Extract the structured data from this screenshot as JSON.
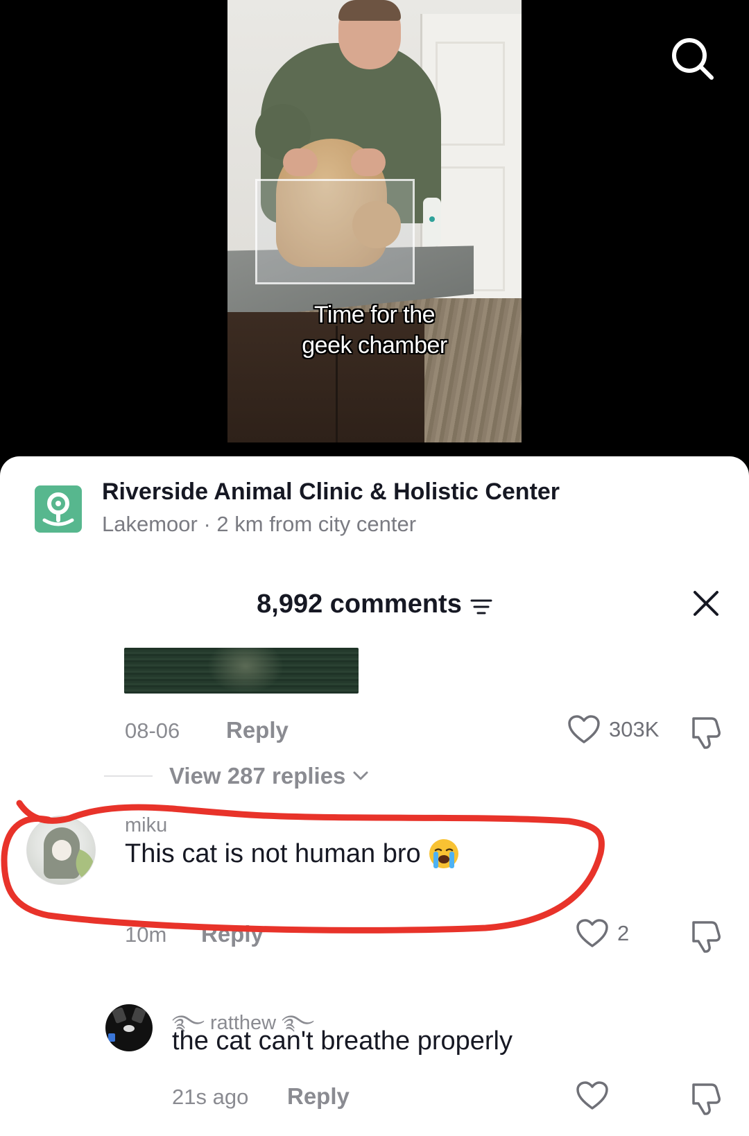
{
  "video": {
    "caption_lines": [
      "Time for the",
      "geek chamber"
    ]
  },
  "location": {
    "title": "Riverside Animal Clinic & Holistic Center",
    "subtitle": "Lakemoor · 2 km from city center",
    "icon": "location-pin-icon",
    "icon_color": "#57b78e"
  },
  "comments_header": {
    "count_label": "8,992 comments"
  },
  "comments": [
    {
      "time": "08-06",
      "reply_label": "Reply",
      "likes": "303K",
      "view_replies_label": "View 287 replies"
    },
    {
      "username": "miku",
      "text": "This cat is not human bro",
      "emoji": "loudly-crying-face",
      "time": "10m",
      "reply_label": "Reply",
      "likes": "2"
    },
    {
      "username": "ratthew",
      "text": "the cat can't breathe properly",
      "time": "21s ago",
      "reply_label": "Reply",
      "likes": ""
    }
  ],
  "colors": {
    "annotation_red": "#e8332a",
    "text_primary": "#161823",
    "text_secondary": "#8a8b91"
  }
}
